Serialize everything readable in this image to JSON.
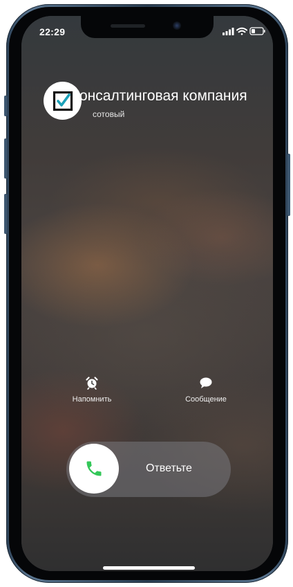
{
  "status_bar": {
    "time": "22:29",
    "icons": [
      "signal-icon",
      "wifi-icon",
      "battery-icon"
    ]
  },
  "caller": {
    "name": "онсалтинговая компания",
    "type": "сотовый",
    "avatar_icon": "checkbox-icon"
  },
  "actions": [
    {
      "label": "Напомнить",
      "icon": "alarm-clock-icon"
    },
    {
      "label": "Сообщение",
      "icon": "speech-bubble-icon"
    }
  ],
  "answer_slider": {
    "label": "Ответьте",
    "icon": "phone-icon"
  },
  "colors": {
    "accept_green": "#34c759",
    "frame_blue": "#3c5670"
  }
}
